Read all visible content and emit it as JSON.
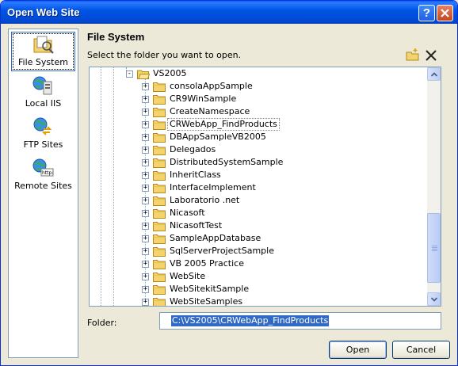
{
  "window": {
    "title": "Open Web Site"
  },
  "titlebar_buttons": {
    "help": "?",
    "close": "X"
  },
  "places": [
    {
      "label": "File System",
      "icon": "file-system-icon",
      "selected": true
    },
    {
      "label": "Local IIS",
      "icon": "local-iis-icon",
      "selected": false
    },
    {
      "label": "FTP Sites",
      "icon": "ftp-sites-icon",
      "selected": false
    },
    {
      "label": "Remote Sites",
      "icon": "remote-sites-icon",
      "selected": false
    }
  ],
  "main": {
    "heading": "File System",
    "instruction": "Select the folder you want to open."
  },
  "tree": {
    "root": {
      "label": "VS2005",
      "expander": "-"
    },
    "children": [
      {
        "label": "consolaAppSample",
        "expander": "+"
      },
      {
        "label": "CR9WinSample",
        "expander": "+"
      },
      {
        "label": "CreateNamespace",
        "expander": "+"
      },
      {
        "label": "CRWebApp_FindProducts",
        "expander": "+",
        "selected": true
      },
      {
        "label": "DBAppSampleVB2005",
        "expander": "+"
      },
      {
        "label": "Delegados",
        "expander": "+"
      },
      {
        "label": "DistributedSystemSample",
        "expander": "+"
      },
      {
        "label": "InheritClass",
        "expander": "+"
      },
      {
        "label": "InterfaceImplement",
        "expander": "+"
      },
      {
        "label": "Laboratorio .net",
        "expander": "+"
      },
      {
        "label": "Nicasoft",
        "expander": "+"
      },
      {
        "label": "NicasoftTest",
        "expander": "+"
      },
      {
        "label": "SampleAppDatabase",
        "expander": "+"
      },
      {
        "label": "SqlServerProjectSample",
        "expander": "+"
      },
      {
        "label": "VB 2005 Practice",
        "expander": "+"
      },
      {
        "label": "WebSite",
        "expander": "+"
      },
      {
        "label": "WebSitekitSample",
        "expander": "+"
      },
      {
        "label": "WebSiteSamples",
        "expander": "+"
      }
    ]
  },
  "folder": {
    "label": "Folder:",
    "value": "C:\\VS2005\\CRWebApp_FindProducts"
  },
  "buttons": {
    "open": "Open",
    "cancel": "Cancel"
  },
  "colors": {
    "titlebar": "#0055e5",
    "selection": "#316ac5",
    "dialog_bg": "#ece9d8",
    "folder_yellow": "#f5d36c"
  }
}
